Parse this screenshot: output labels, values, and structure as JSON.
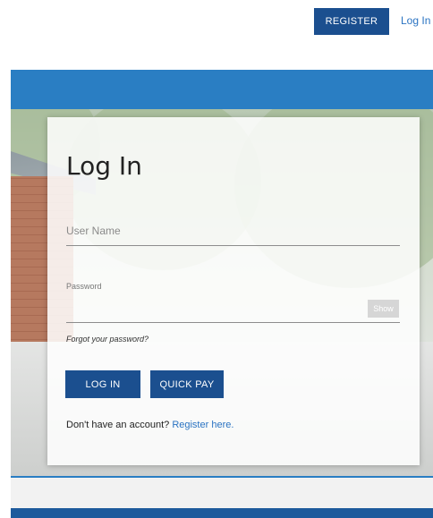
{
  "header": {
    "register_label": "REGISTER",
    "login_link": "Log In"
  },
  "login_card": {
    "title": "Log In",
    "username_placeholder": "User Name",
    "password_label": "Password",
    "show_label": "Show",
    "forgot_text": "Forgot your password?",
    "login_button": "LOG IN",
    "quickpay_button": "QUICK PAY",
    "signup_prompt": "Don't have an account?",
    "signup_link": "Register here."
  },
  "colors": {
    "brand_blue": "#1b4f8f",
    "accent_blue": "#2a7ec3",
    "link_blue": "#2a73c2"
  }
}
